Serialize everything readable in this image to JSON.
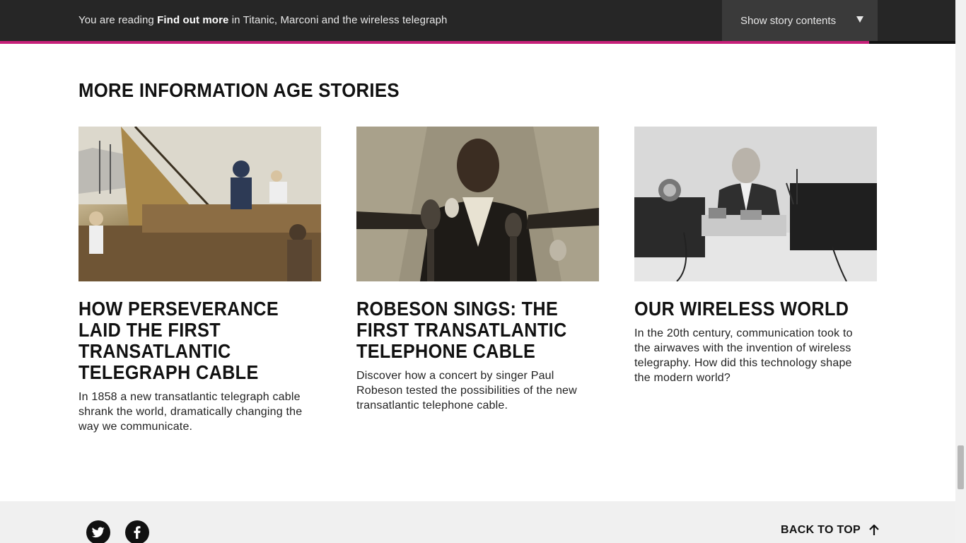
{
  "topbar": {
    "reading_prefix": "You are reading",
    "reading_bold": "Find out more",
    "reading_suffix": "in Titanic, Marconi and the wireless telegraph",
    "story_button_label": "Show story contents",
    "progress_fraction": 0.91,
    "progress_color": "#c7207a"
  },
  "section": {
    "title": "MORE INFORMATION AGE STORIES"
  },
  "cards": [
    {
      "headline": "HOW PERSEVERANCE LAID THE FIRST TRANSATLANTIC TELEGRAPH CABLE",
      "description": "In 1858 a new transatlantic telegraph cable shrank the world, dramatically changing the way we communicate."
    },
    {
      "headline": "ROBESON SINGS: THE FIRST TRANSATLANTIC TELEPHONE CABLE",
      "description": "Discover how a concert by singer Paul Robeson tested the possibilities of the new transatlantic telephone cable."
    },
    {
      "headline": "OUR WIRELESS WORLD",
      "description": "In the 20th century, communication took to the airwaves with the invention of wireless telegraphy. How did this technology shape the modern world?"
    }
  ],
  "footer": {
    "social_icons": [
      "twitter-icon",
      "facebook-icon"
    ],
    "back_to_top_label": "BACK TO TOP"
  }
}
